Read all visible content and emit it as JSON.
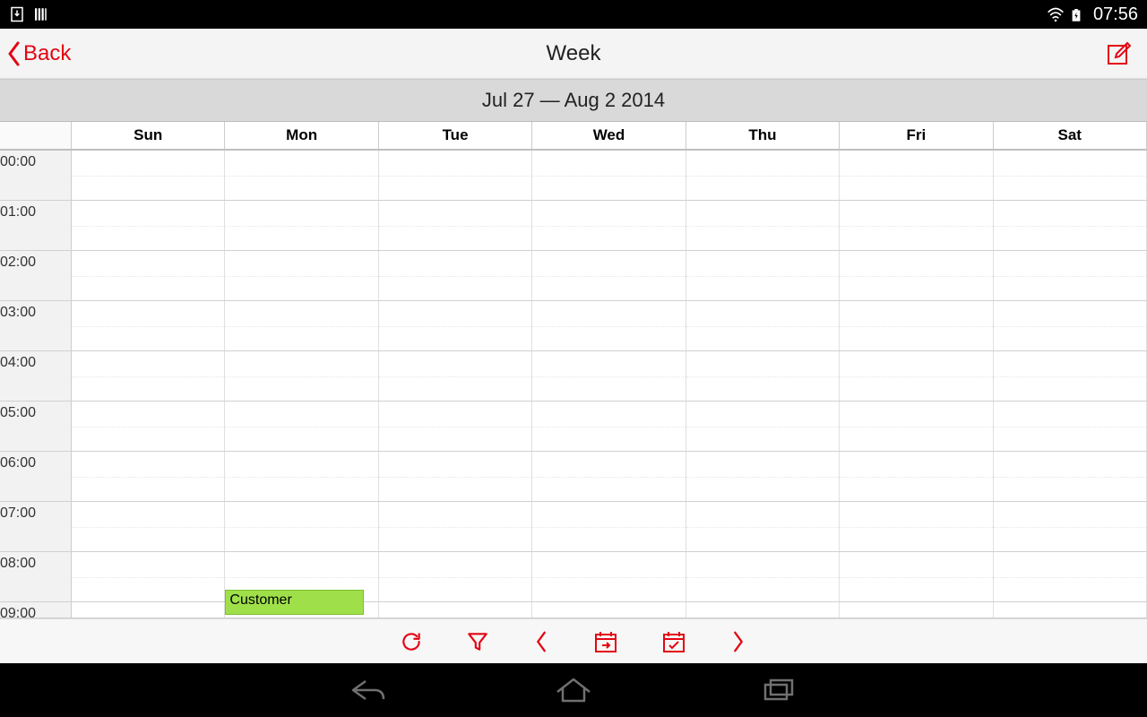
{
  "status": {
    "time": "07:56"
  },
  "nav": {
    "back_label": "Back",
    "title": "Week"
  },
  "range": {
    "label": "Jul 27 — Aug 2 2014"
  },
  "days": [
    "Sun",
    "Mon",
    "Tue",
    "Wed",
    "Thu",
    "Fri",
    "Sat"
  ],
  "hours": [
    "00:00",
    "01:00",
    "02:00",
    "03:00",
    "04:00",
    "05:00",
    "06:00",
    "07:00",
    "08:00",
    "09:00"
  ],
  "event": {
    "title": "Customer",
    "day_index": 1,
    "hour_start": 8.75,
    "duration_hours": 0.5
  },
  "colors": {
    "accent": "#e30613",
    "event_bg": "#9fe04a"
  }
}
